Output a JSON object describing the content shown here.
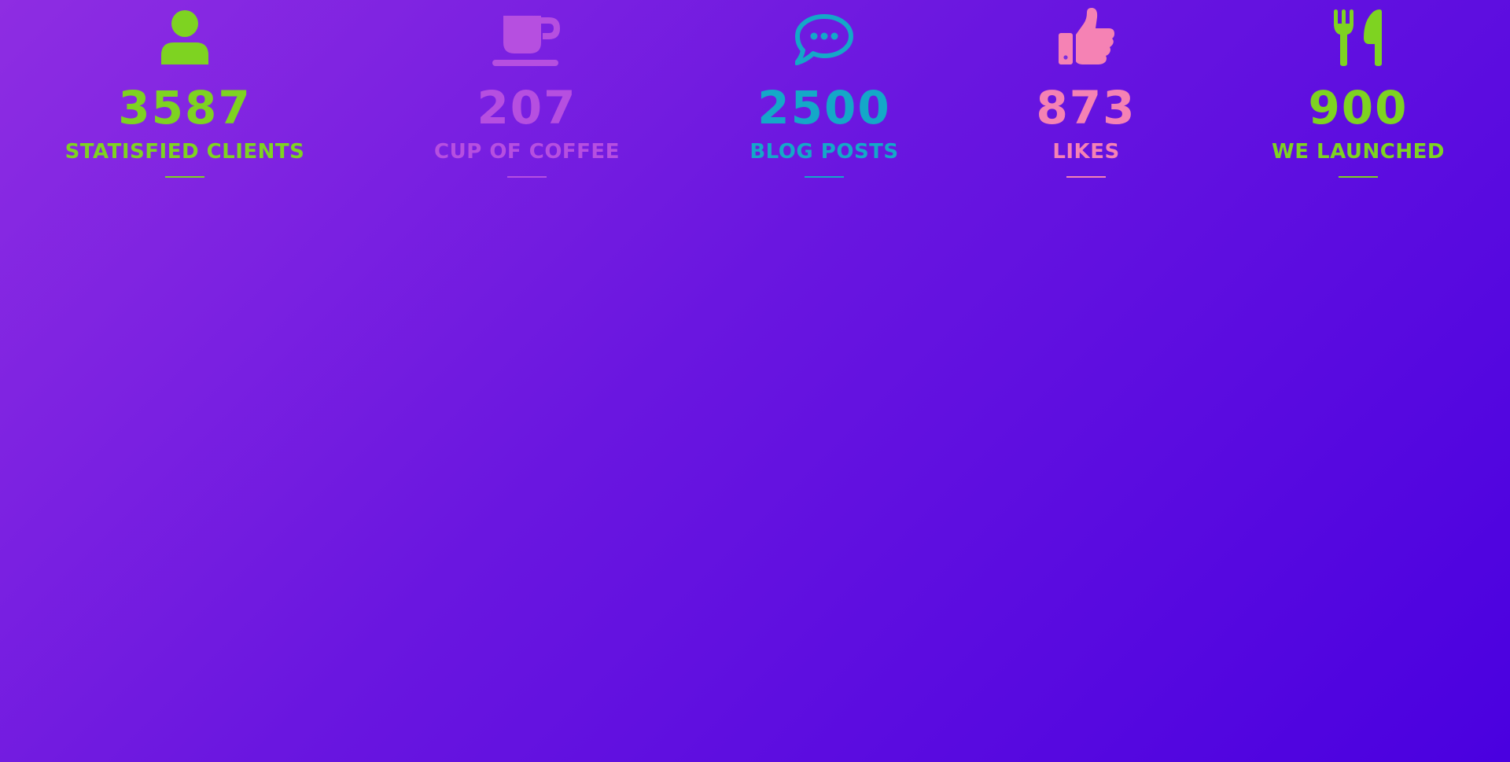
{
  "colors": {
    "green": "#7ed321",
    "purple": "#b64fe0",
    "teal": "#14a8c8",
    "pink": "#f582b4",
    "background_start": "#8e2de2",
    "background_end": "#4a00e0"
  },
  "stats": [
    {
      "icon": "user-icon",
      "number": "3587",
      "label": "STATISFIED CLIENTS",
      "color": "#7ed321"
    },
    {
      "icon": "coffee-cup-icon",
      "number": "207",
      "label": "CUP OF COFFEE",
      "color": "#b64fe0"
    },
    {
      "icon": "chat-bubble-icon",
      "number": "2500",
      "label": "BLOG POSTS",
      "color": "#14a8c8"
    },
    {
      "icon": "thumbs-up-icon",
      "number": "873",
      "label": "LIKES",
      "color": "#f582b4"
    },
    {
      "icon": "fork-knife-icon",
      "number": "900",
      "label": "WE LAUNCHED",
      "color": "#7ed321"
    }
  ]
}
